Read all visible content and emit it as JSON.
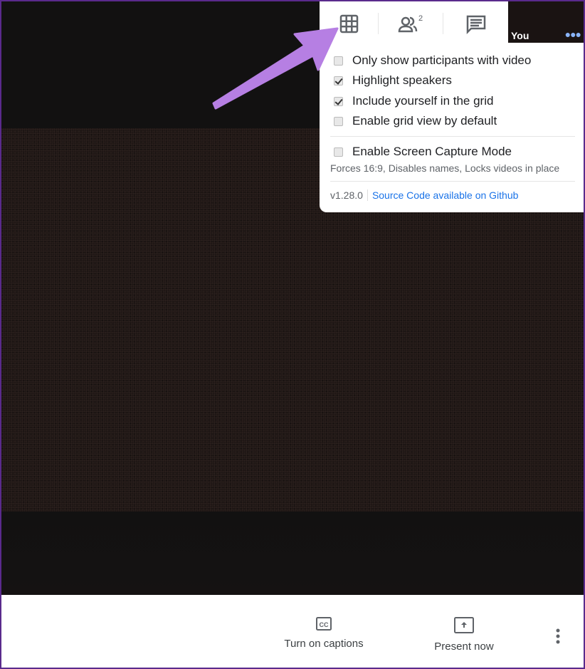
{
  "self_tile": {
    "name": "You",
    "more_icon": "more-horizontal-icon"
  },
  "panel": {
    "tabs": [
      {
        "icon": "grid-icon"
      },
      {
        "icon": "people-icon",
        "badge": "2"
      },
      {
        "icon": "chat-icon"
      }
    ],
    "options": [
      {
        "label": "Only show participants with video",
        "checked": false
      },
      {
        "label": "Highlight speakers",
        "checked": true
      },
      {
        "label": "Include yourself in the grid",
        "checked": true
      },
      {
        "label": "Enable grid view by default",
        "checked": false
      }
    ],
    "screen_capture": {
      "label": "Enable Screen Capture Mode",
      "checked": false,
      "note": "Forces 16:9, Disables names, Locks videos in place"
    },
    "version": "v1.28.0",
    "source_link": "Source Code available on Github"
  },
  "bottom_bar": {
    "captions_label": "Turn on captions",
    "present_label": "Present now"
  },
  "colors": {
    "arrow": "#b67fe3",
    "link": "#1a73e8",
    "frame": "#5a2a8c"
  }
}
